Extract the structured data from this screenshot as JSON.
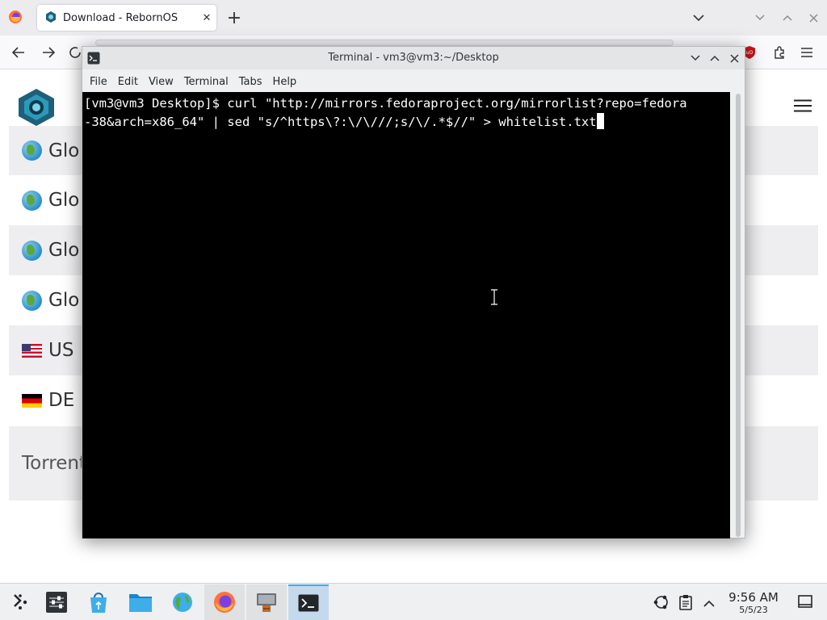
{
  "browser": {
    "tab": {
      "title": "Download - RebornOS",
      "close_label": "✕",
      "icon": "reborn-logo-icon"
    },
    "new_tab_label": "+",
    "controls": {
      "list_all_tabs": "⌄",
      "minimize": "⌄",
      "maximize": "⌃",
      "close": "✕"
    }
  },
  "website": {
    "mirrors": [
      {
        "label": "Glo",
        "icon": "globe-icon"
      },
      {
        "label": "Glo",
        "icon": "globe-icon"
      },
      {
        "label": "Glo",
        "icon": "globe-icon"
      },
      {
        "label": "Glo",
        "icon": "globe-icon"
      },
      {
        "label": "US",
        "icon": "us-flag-icon"
      },
      {
        "label": "DE",
        "icon": "de-flag-icon"
      }
    ],
    "torrent_label": "Torrent"
  },
  "terminal": {
    "title": "Terminal - vm3@vm3:~/Desktop",
    "menu": [
      "File",
      "Edit",
      "View",
      "Terminal",
      "Tabs",
      "Help"
    ],
    "lines": [
      "[vm3@vm3 Desktop]$ curl \"http://mirrors.fedoraproject.org/mirrorlist?repo=fedora",
      "-38&arch=x86_64\" | sed \"s/^https\\?:\\/\\///;s/\\/.*$//\" > whitelist.txt"
    ],
    "background": "#000000",
    "foreground": "#ffffff"
  },
  "taskbar": {
    "apps": [
      {
        "name": "application-launcher",
        "state": "normal"
      },
      {
        "name": "system-settings",
        "state": "normal"
      },
      {
        "name": "software-store",
        "state": "normal"
      },
      {
        "name": "file-manager",
        "state": "normal"
      },
      {
        "name": "web-browser",
        "state": "normal"
      },
      {
        "name": "firefox",
        "state": "open"
      },
      {
        "name": "installer",
        "state": "open"
      },
      {
        "name": "terminal",
        "state": "active"
      }
    ],
    "clock": {
      "time": "9:56 AM",
      "date": "5/5/23"
    }
  },
  "colors": {
    "accent": "#3daee9",
    "site_primary": "#1f5f7a"
  }
}
